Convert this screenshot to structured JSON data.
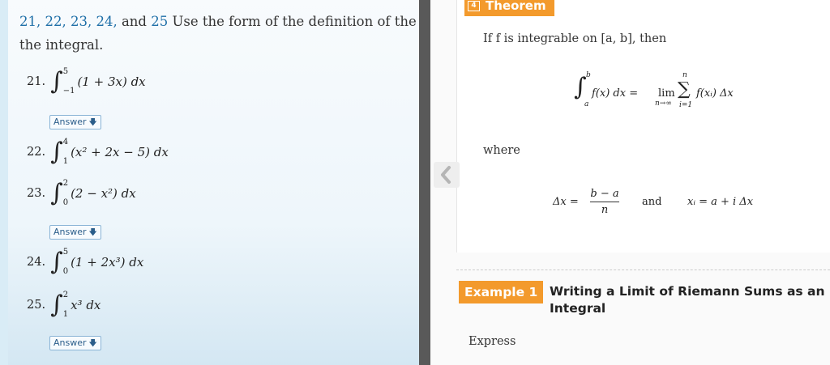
{
  "left": {
    "intro_nums": "21, 22, 23, 24,",
    "intro_and": " and ",
    "intro_num25": "25",
    "intro_rest": " Use the form of the definition of the integral",
    "intro_line2": "the integral.",
    "answer_label": "Answer",
    "problems": [
      {
        "num": "21.",
        "upper": "5",
        "lower": "−1",
        "expr": "(1 + 3x) dx"
      },
      {
        "num": "22.",
        "upper": "4",
        "lower": "1",
        "expr": "(x² + 2x − 5) dx"
      },
      {
        "num": "23.",
        "upper": "2",
        "lower": "0",
        "expr": "(2 − x²) dx"
      },
      {
        "num": "24.",
        "upper": "5",
        "lower": "0",
        "expr": "(1 + 2x³) dx"
      },
      {
        "num": "25.",
        "upper": "2",
        "lower": "1",
        "expr": "x³ dx"
      }
    ]
  },
  "right": {
    "theorem_num": "4",
    "theorem_label": "Theorem",
    "if_text": "If f is integrable on [a, b], then",
    "formula_lhs": "f(x) dx =",
    "lim_text": "lim",
    "lim_sub": "n→∞",
    "sum_top": "n",
    "sum_bottom": "i=1",
    "sum_term": "f(xᵢ) Δx",
    "int_upper": "b",
    "int_lower": "a",
    "where_text": "where",
    "delta_lhs": "Δx =",
    "frac_num": "b − a",
    "frac_den": "n",
    "and_text": "and",
    "xi_text": "xᵢ = a + i Δx",
    "example_label": "Example 1",
    "example_title": "Writing a Limit of Riemann Sums as an Integral",
    "express_text": "Express"
  },
  "colors": {
    "accent": "#f39a2c",
    "link": "#1f6fa8",
    "divider": "#595959"
  }
}
